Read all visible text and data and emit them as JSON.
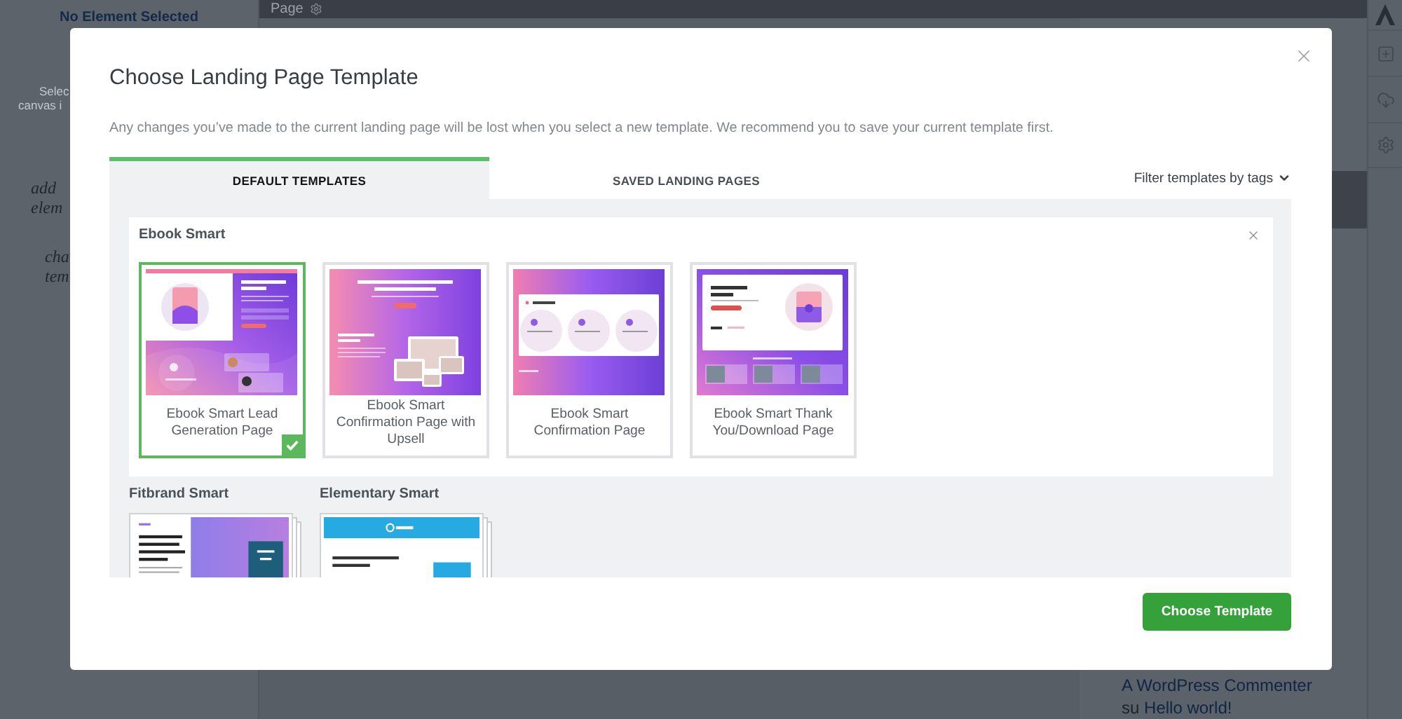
{
  "builder": {
    "sidebar": {
      "title": "No Element Selected",
      "hint_lines": [
        "Selec",
        "canvas i"
      ],
      "notes": [
        {
          "lines": [
            "add",
            "elem"
          ]
        },
        {
          "lines": [
            "cha",
            "tem"
          ]
        }
      ]
    },
    "top_bar": {
      "label": "Page"
    },
    "recent_comment": {
      "author": "A WordPress Commenter",
      "connector": "su",
      "post": "Hello world!"
    }
  },
  "modal": {
    "title": "Choose Landing Page Template",
    "description": "Any changes you’ve made to the current landing page will be lost when you select a new template. We recommend you to save your current template first.",
    "tabs": [
      {
        "label": "DEFAULT TEMPLATES",
        "selected": true
      },
      {
        "label": "SAVED LANDING PAGES",
        "selected": false
      }
    ],
    "filter": {
      "label": "Filter templates by tags"
    },
    "groups": [
      {
        "name": "Ebook Smart",
        "expanded": true,
        "templates": [
          {
            "name": "Ebook Smart Lead Generation Page",
            "kind": "lead",
            "selected": true
          },
          {
            "name": "Ebook Smart Confirmation Page with Upsell",
            "kind": "upsell",
            "selected": false
          },
          {
            "name": "Ebook Smart Confirmation Page",
            "kind": "steps",
            "selected": false
          },
          {
            "name": "Ebook Smart Thank You/Download Page",
            "kind": "download",
            "selected": false
          }
        ]
      },
      {
        "name": "Fitbrand Smart",
        "expanded": false,
        "preview": {
          "kind": "split"
        }
      },
      {
        "name": "Elementary Smart",
        "expanded": false,
        "preview": {
          "kind": "banner"
        }
      }
    ],
    "primary_button": "Choose Template"
  }
}
